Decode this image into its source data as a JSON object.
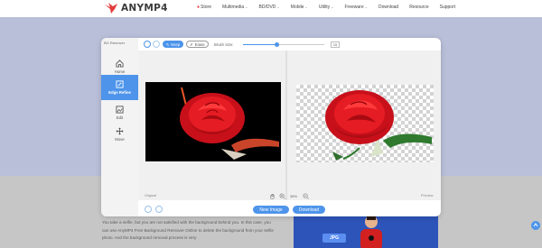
{
  "site": {
    "brand": "ANYMP4",
    "nav": [
      {
        "label": "Store",
        "dropdown": false,
        "dot": true
      },
      {
        "label": "Multimedia",
        "dropdown": true
      },
      {
        "label": "BD/DVD",
        "dropdown": true
      },
      {
        "label": "Mobile",
        "dropdown": true
      },
      {
        "label": "Utility",
        "dropdown": true
      },
      {
        "label": "Freeware",
        "dropdown": true
      },
      {
        "label": "Download",
        "dropdown": false
      },
      {
        "label": "Resource",
        "dropdown": false
      },
      {
        "label": "Support",
        "dropdown": false
      }
    ],
    "dropdown_glyph": "⌄",
    "store_glyph": "●"
  },
  "article": {
    "text": "You take a selfie, but you are not satisfied with the background behind you. In this case, you can use AnyMP4 Free Background Remover Online to delete the background from your selfie photo. And the background removal process is very"
  },
  "promo": {
    "badge": "JPG"
  },
  "editor": {
    "sidebar_title": "BG Remover",
    "sidebar": [
      {
        "label": "Home",
        "icon": "home-icon",
        "active": false
      },
      {
        "label": "Edge Refine",
        "icon": "edge-refine-icon",
        "active": true
      },
      {
        "label": "Edit",
        "icon": "image-edit-icon",
        "active": false
      },
      {
        "label": "Move",
        "icon": "move-icon",
        "active": false
      }
    ],
    "toolbar": {
      "keep_label": "Keep",
      "erase_label": "Erase",
      "brush_label": "Brush Size:",
      "brush_value": "15",
      "brush_fraction": 0.42
    },
    "original_label": "Original",
    "preview_label": "Preview",
    "zoom": "38%",
    "new_image_label": "New Image",
    "download_label": "Download"
  },
  "colors": {
    "accent": "#4d94ea",
    "hero_bg": "#b9bfd8",
    "rose_red": "#d8151b",
    "stem_green": "#3a8a3a"
  }
}
